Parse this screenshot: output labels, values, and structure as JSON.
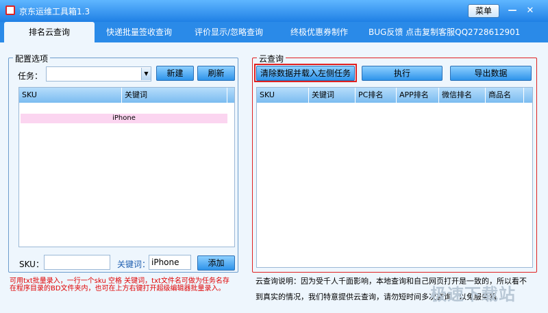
{
  "window": {
    "title": "京东运维工具箱1.3",
    "menu_label": "菜单",
    "minimize": "—",
    "close": "✕"
  },
  "tabs": [
    {
      "label": "排名云查询",
      "active": true
    },
    {
      "label": "快递批量签收查询"
    },
    {
      "label": "评价显示/忽略查询"
    },
    {
      "label": "终极优惠券制作"
    }
  ],
  "bug_text": "BUG反馈 点击复制客服QQ2728612901",
  "config": {
    "title": "配置选项",
    "task_label": "任务：",
    "task_value": "",
    "new_button": "新建",
    "refresh_button": "刷新",
    "columns": [
      "SKU",
      "关键词"
    ],
    "rows": [
      {
        "text": "iPhone"
      }
    ],
    "sku_label": "SKU：",
    "sku_value": "",
    "keyword_label": "关键词：",
    "keyword_value": "iPhone",
    "add_button": "添加",
    "note": "可用txt批量录入，一行一个sku 空格 关键词，txt文件名可做为任务名存在程序目录的BD文件夹内，也可在上方右键打开超级编辑器批量录入。"
  },
  "cloud": {
    "title": "云查询",
    "clear_button": "清除数据并载入左侧任务",
    "execute_button": "执行",
    "export_button": "导出数据",
    "columns": [
      "SKU",
      "关键词",
      "PC排名",
      "APP排名",
      "微信排名",
      "商品名"
    ],
    "note_line1": "云查询说明：因为受千人千面影响，本地查询和自己网页打开是一致的，所以看不",
    "note_line2": "到真实的情况，我们特意提供云查询，请勿短时间多次查询，以免服务器"
  },
  "watermark": "极速下载站",
  "colors": {
    "titlebar": "#1f80e5",
    "highlight_border": "#e02020",
    "note_text": "#e00000",
    "row_highlight": "#fbd5f0"
  }
}
